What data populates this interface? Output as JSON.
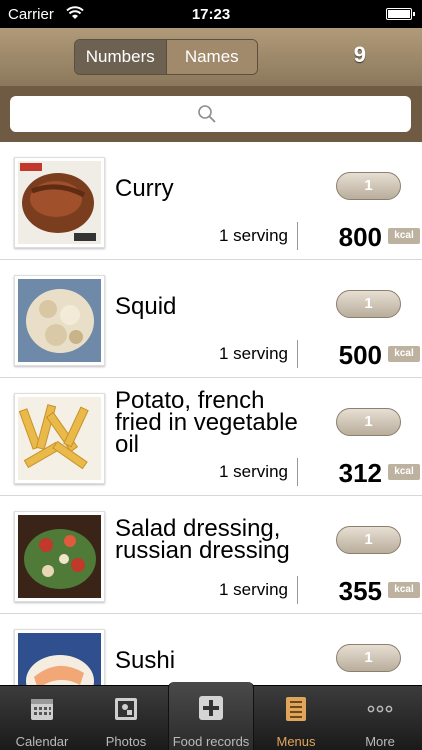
{
  "status_bar": {
    "carrier": "Carrier",
    "time": "17:23"
  },
  "header": {
    "segments": [
      "Numbers",
      "Names"
    ],
    "selected_segment": "Numbers",
    "count": "9"
  },
  "search": {
    "placeholder": ""
  },
  "items": [
    {
      "name_lines": [
        "Curry"
      ],
      "quantity": "1",
      "serving": "1 serving",
      "kcal": "800",
      "kcal_unit": "kcal"
    },
    {
      "name_lines": [
        "Squid"
      ],
      "quantity": "1",
      "serving": "1 serving",
      "kcal": "500",
      "kcal_unit": "kcal"
    },
    {
      "name_lines": [
        "Potato, french",
        "fried in vegetable",
        "oil"
      ],
      "quantity": "1",
      "serving": "1 serving",
      "kcal": "312",
      "kcal_unit": "kcal"
    },
    {
      "name_lines": [
        "Salad dressing,",
        "russian dressing"
      ],
      "quantity": "1",
      "serving": "1 serving",
      "kcal": "355",
      "kcal_unit": "kcal"
    },
    {
      "name_lines": [
        "Sushi"
      ],
      "quantity": "1"
    }
  ],
  "tabs": [
    {
      "label": "Calendar",
      "icon": "calendar-icon"
    },
    {
      "label": "Photos",
      "icon": "photos-icon"
    },
    {
      "label": "Food records",
      "icon": "add-record-icon"
    },
    {
      "label": "Menus",
      "icon": "menus-icon",
      "active": true
    },
    {
      "label": "More",
      "icon": "more-icon"
    }
  ],
  "colors": {
    "accent": "#e0a55a",
    "header": "#a08a6b",
    "search_bg": "#6f5a44"
  }
}
